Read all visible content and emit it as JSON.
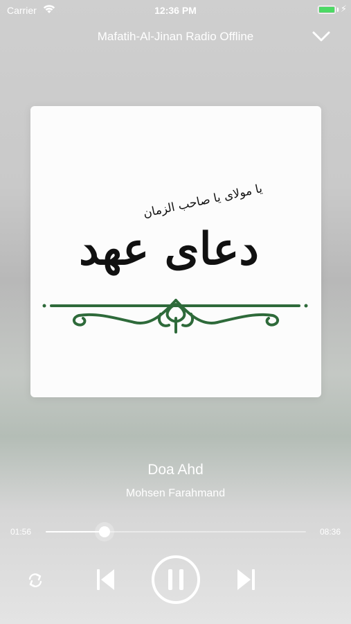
{
  "status_bar": {
    "carrier": "Carrier",
    "time": "12:36 PM"
  },
  "player": {
    "title": "Mafatih-Al-Jinan Radio Offline",
    "artwork_text": {
      "main": "دعای عهد",
      "subtitle": "یا مولای یا صاحب الزمان"
    },
    "track": {
      "title": "Doa Ahd",
      "artist": "Mohsen Farahmand",
      "elapsed": "01:56",
      "duration": "08:36",
      "progress": 0.225
    }
  },
  "colors": {
    "ornament": "#2e6a3a",
    "battery": "#4cd964",
    "text": "#ffffff"
  },
  "icons": {
    "collapse": "chevron-down-icon",
    "repeat": "repeat-icon",
    "previous": "skip-previous-icon",
    "pause": "pause-icon",
    "next": "skip-next-icon"
  }
}
